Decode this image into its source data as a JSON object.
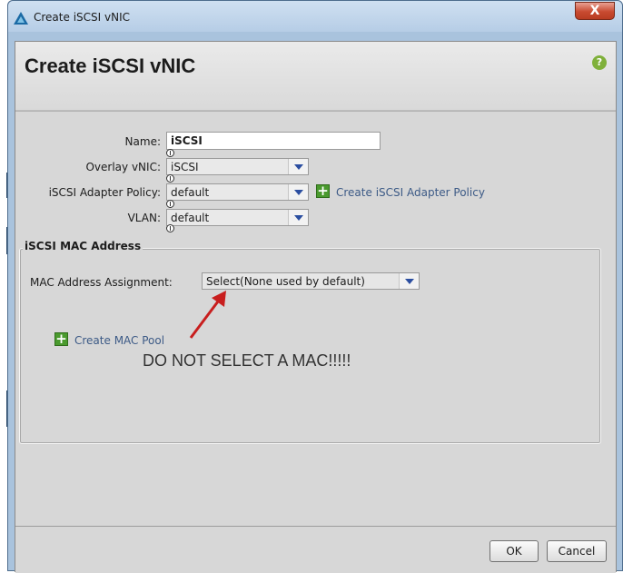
{
  "window": {
    "title": "Create iSCSI vNIC",
    "close_label": "X"
  },
  "dialog": {
    "heading": "Create iSCSI vNIC",
    "help_glyph": "?"
  },
  "form": {
    "name_label": "Name:",
    "name_value": "iSCSI",
    "overlay_label": "Overlay vNIC:",
    "overlay_value": "iSCSI",
    "adapter_policy_label": "iSCSI Adapter Policy:",
    "adapter_policy_value": "default",
    "create_adapter_policy_link": "Create iSCSI Adapter Policy",
    "vlan_label": "VLAN:",
    "vlan_value": "default"
  },
  "mac_section": {
    "legend": "iSCSI MAC Address",
    "assignment_label": "MAC Address Assignment:",
    "assignment_value": "Select(None used by default)",
    "create_pool_link": "Create MAC Pool",
    "annotation_text": "DO NOT SELECT A MAC!!!!!"
  },
  "buttons": {
    "ok": "OK",
    "cancel": "Cancel"
  },
  "colors": {
    "annotation_arrow": "#c81e1e",
    "plus_icon": "#4a9a2e",
    "help_icon": "#7fb03a"
  }
}
